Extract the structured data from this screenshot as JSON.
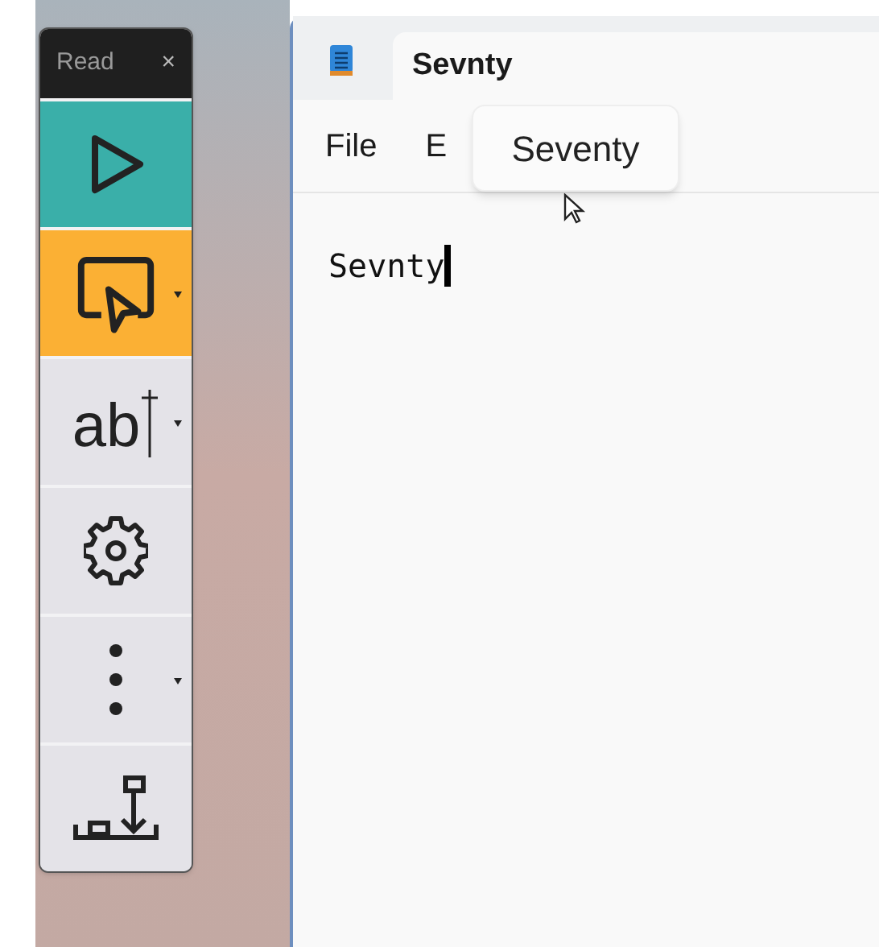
{
  "toolbar": {
    "title": "Read",
    "close": "×",
    "buttons": [
      {
        "kind": "play",
        "color": "#3aafa9",
        "dropdown": false
      },
      {
        "kind": "select",
        "color": "#fbb034",
        "dropdown": true
      },
      {
        "kind": "text",
        "label": "ab",
        "color": "#e4e3e8",
        "dropdown": true
      },
      {
        "kind": "settings",
        "color": "#e4e3e8",
        "dropdown": false
      },
      {
        "kind": "more",
        "color": "#e4e3e8",
        "dropdown": true
      },
      {
        "kind": "export",
        "color": "#e4e3e8",
        "dropdown": false
      }
    ]
  },
  "notepad": {
    "tab": {
      "title": "Sevnty"
    },
    "menu": [
      "File",
      "E"
    ],
    "tooltip": "Seventy",
    "content": "Sevnty"
  }
}
